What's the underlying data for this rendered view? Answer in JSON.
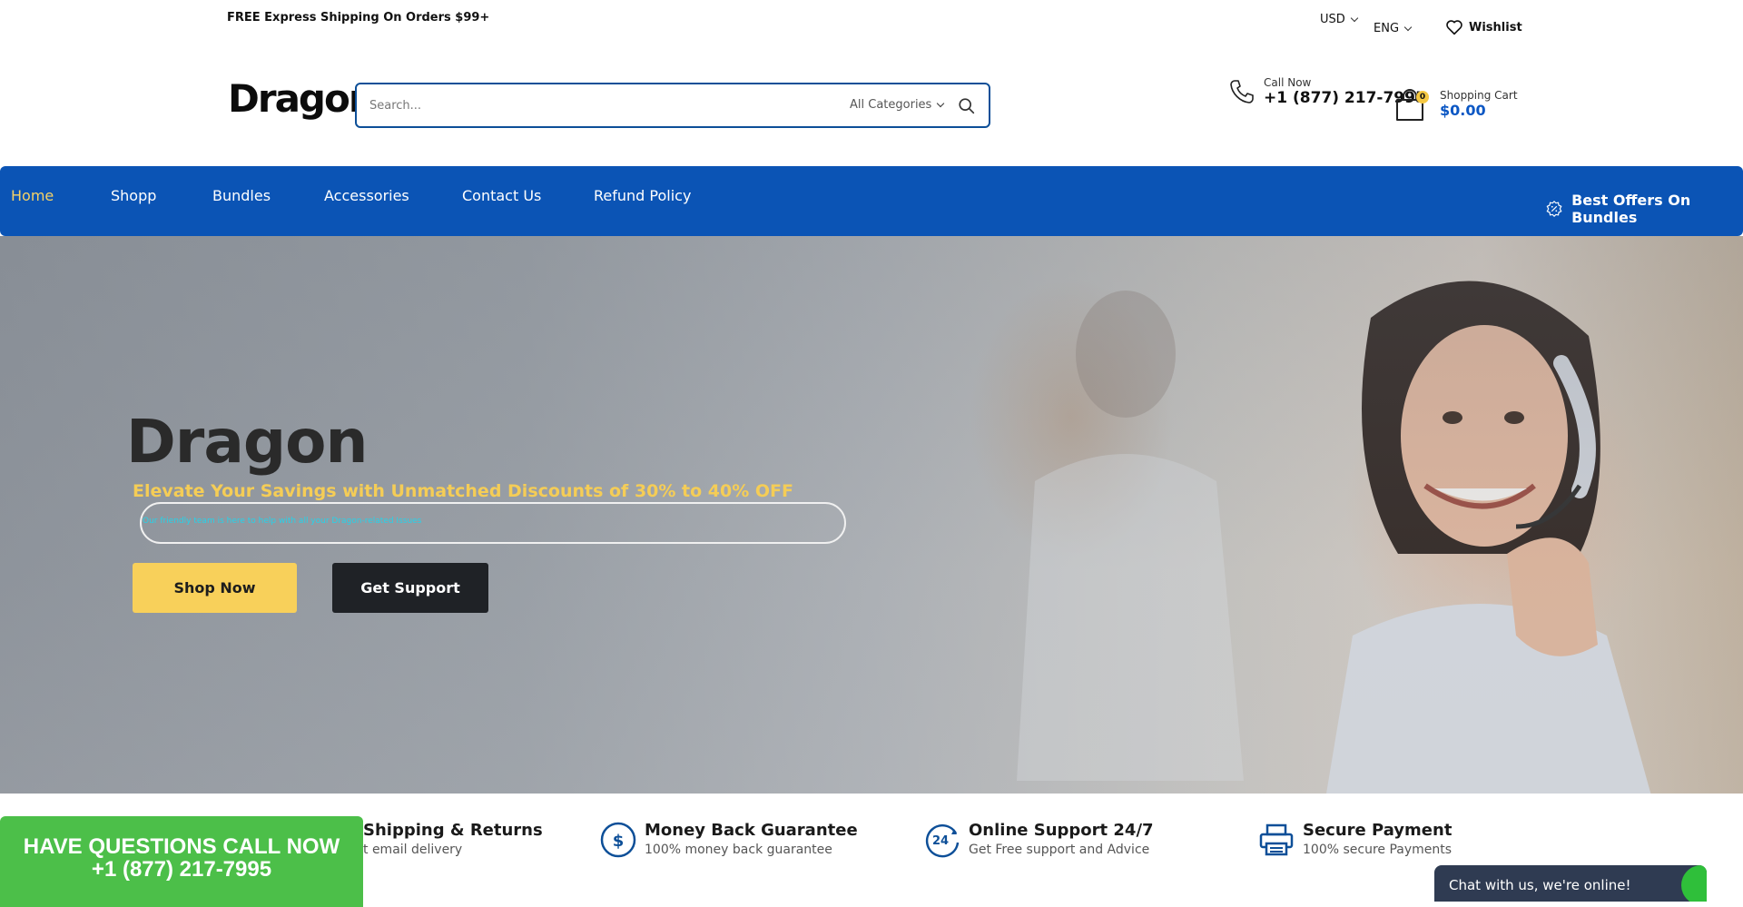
{
  "topbar": {
    "promo": "FREE Express Shipping On Orders $99+",
    "currency": "USD",
    "language": "ENG",
    "wishlist": "Wishlist"
  },
  "header": {
    "logo": "Dragon",
    "search_placeholder": "Search...",
    "category": "All Categories",
    "call_label": "Call Now",
    "call_number": "+1 (877) 217-7995",
    "cart_count": "0",
    "cart_label": "Shopping Cart",
    "cart_total": "$0.00"
  },
  "nav": {
    "items": [
      "Home",
      "Shopp",
      "Bundles",
      "Accessories",
      "Contact Us",
      "Refund Policy"
    ],
    "offers": "Best Offers On Bundles"
  },
  "hero": {
    "title": "Dragon",
    "subtitle": "Elevate Your Savings with Unmatched Discounts of 30% to 40% OFF",
    "note": "Our friendly team is here to help with all your Dragon-related Issues",
    "shop_button": "Shop Now",
    "support_button": "Get Support"
  },
  "features": [
    {
      "title": "Shipping & Returns",
      "subtitle": "t email delivery",
      "icon": "shipping-icon"
    },
    {
      "title": "Money Back Guarantee",
      "subtitle": "100% money back guarantee",
      "icon": "dollar-icon"
    },
    {
      "title": "Online Support 24/7",
      "subtitle": "Get Free support and Advice",
      "icon": "support-24-icon"
    },
    {
      "title": "Secure Payment",
      "subtitle": "100% secure Payments",
      "icon": "printer-icon"
    }
  ],
  "call_banner": {
    "line1": "HAVE QUESTIONS CALL NOW",
    "line2": "+1 (877) 217-7995"
  },
  "chat": {
    "label": "Chat with us, we're online!"
  },
  "colors": {
    "nav_bg": "#0b54b5",
    "accent_yellow": "#f8d05a",
    "search_border": "#0d4f98",
    "call_green": "#4cbf49",
    "chat_bg": "#2f3b52"
  }
}
